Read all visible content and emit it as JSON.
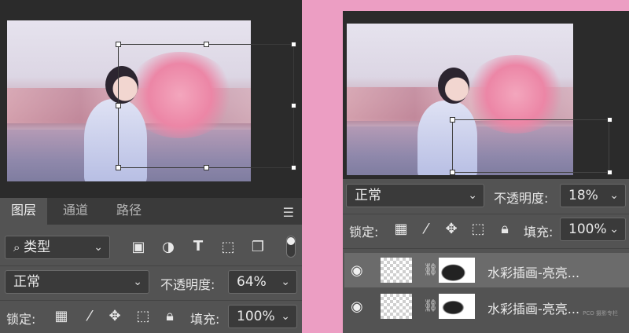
{
  "layers_panel_left": {
    "tabs": [
      {
        "label": "图层",
        "active": true
      },
      {
        "label": "通道",
        "active": false
      },
      {
        "label": "路径",
        "active": false
      }
    ],
    "filter_label": "类型",
    "blend_mode": "正常",
    "opacity_label": "不透明度:",
    "opacity_value": "64%",
    "lock_label": "锁定:",
    "fill_label": "填充:",
    "fill_value": "100%"
  },
  "layers_panel_right": {
    "blend_mode": "正常",
    "opacity_label": "不透明度:",
    "opacity_value": "18%",
    "lock_label": "锁定:",
    "fill_label": "填充:",
    "fill_value": "100%",
    "layers": [
      {
        "name": "水彩插画-亮亮...",
        "visible": true,
        "selected": true
      },
      {
        "name": "水彩插画-亮亮...",
        "visible": true,
        "selected": false
      }
    ]
  },
  "icons": [
    "search-icon",
    "image-filter-icon",
    "adjustment-filter-icon",
    "type-filter-icon",
    "shape-filter-icon",
    "smart-object-filter-icon",
    "lock-transparent-icon",
    "lock-paint-icon",
    "lock-position-icon",
    "lock-artboard-icon",
    "lock-all-icon",
    "eye-icon",
    "link-icon",
    "panel-menu-icon"
  ],
  "colors": {
    "background": "#ec9ec3",
    "panel": "#535353",
    "panel_dark": "#2b2b2b",
    "selected_row": "#6b6b6b"
  },
  "watermark": "PCO 摄影专栏"
}
